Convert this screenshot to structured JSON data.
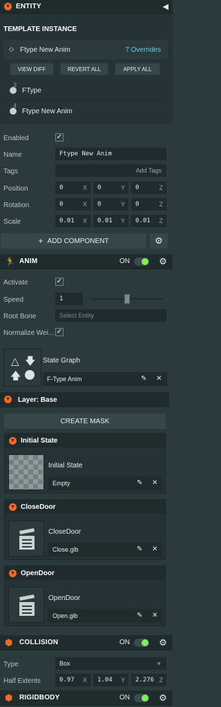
{
  "entity": {
    "title": "ENTITY",
    "template": {
      "heading": "TEMPLATE INSTANCE",
      "name": "Ftype New Anim",
      "overrides": "7 Overrides",
      "view_diff": "VIEW DIFF",
      "revert_all": "REVERT ALL",
      "apply_all": "APPLY ALL",
      "items": [
        {
          "index": "3",
          "label": "FType"
        },
        {
          "index": "4",
          "label": "Ftype New Anim"
        }
      ]
    },
    "enabled_label": "Enabled",
    "enabled_checked": true,
    "name_label": "Name",
    "name_value": "Ftype New Anim",
    "tags_label": "Tags",
    "tags_placeholder": "Add Tags",
    "position_label": "Position",
    "position": {
      "x": "0",
      "y": "0",
      "z": "0"
    },
    "rotation_label": "Rotation",
    "rotation": {
      "x": "0",
      "y": "0",
      "z": "0"
    },
    "scale_label": "Scale",
    "scale": {
      "x": "0.01",
      "y": "0.01",
      "z": "0.01"
    },
    "add_component": "ADD COMPONENT",
    "axes": {
      "x": "X",
      "y": "Y",
      "z": "Z"
    }
  },
  "anim": {
    "title": "ANIM",
    "on_label": "ON",
    "activate_label": "Activate",
    "speed_label": "Speed",
    "speed_value": "1",
    "speed_slider_fraction": 0.5,
    "root_bone_label": "Root Bone",
    "root_bone_placeholder": "Select Entity",
    "normalize_label": "Normalize Wei...",
    "state_graph_label": "State Graph",
    "state_graph_value": "F-Type Anim",
    "layer_title": "Layer: Base",
    "create_mask": "CREATE MASK",
    "states": [
      {
        "title": "Initial State",
        "name": "Initial State",
        "asset": "Empty"
      },
      {
        "title": "CloseDoor",
        "name": "CloseDoor",
        "asset": "Close.glb"
      },
      {
        "title": "OpenDoor",
        "name": "OpenDoor",
        "asset": "Open.glb"
      }
    ]
  },
  "collision": {
    "title": "COLLISION",
    "on_label": "ON",
    "type_label": "Type",
    "type_value": "Box",
    "half_extents_label": "Half Extents",
    "half_extents": {
      "x": "0.97",
      "y": "1.04",
      "z": "2.276"
    }
  },
  "rigidbody": {
    "title": "RIGIDBODY",
    "on_label": "ON"
  },
  "colors": {
    "accent": "#f26a21",
    "toggle_on": "#7ff05d",
    "overrides": "#5ad0e6",
    "link": "#3fb6e8"
  }
}
